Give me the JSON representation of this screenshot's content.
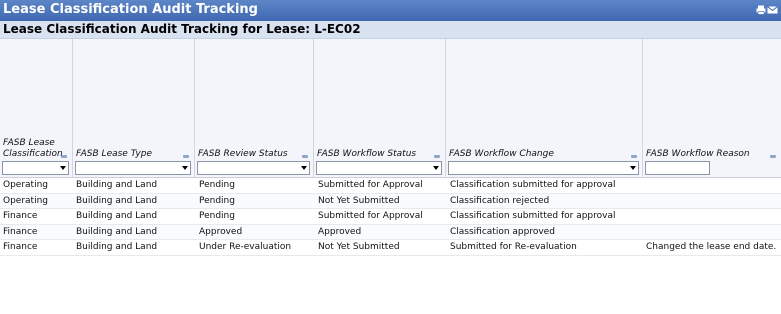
{
  "window": {
    "title": "Lease Classification Audit Tracking"
  },
  "report": {
    "heading": "Lease Classification Audit Tracking for Lease: L-EC02"
  },
  "columns": [
    "FASB Lease Classification",
    "FASB Lease Type",
    "FASB Review Status",
    "FASB Workflow Status",
    "FASB Workflow Change",
    "FASB Workflow Reason"
  ],
  "rows": [
    [
      "Operating",
      "Building and Land",
      "Pending",
      "Submitted for Approval",
      "Classification submitted for approval",
      ""
    ],
    [
      "Operating",
      "Building and Land",
      "Pending",
      "Not Yet Submitted",
      "Classification rejected",
      ""
    ],
    [
      "Finance",
      "Building and Land",
      "Pending",
      "Submitted for Approval",
      "Classification submitted for approval",
      ""
    ],
    [
      "Finance",
      "Building and Land",
      "Approved",
      "Approved",
      "Classification approved",
      ""
    ],
    [
      "Finance",
      "Building and Land",
      "Under Re-evaluation",
      "Not Yet Submitted",
      "Submitted for Re-evaluation",
      "Changed the lease end date."
    ]
  ],
  "icons": {
    "print": "printer-icon",
    "email": "envelope-icon"
  }
}
